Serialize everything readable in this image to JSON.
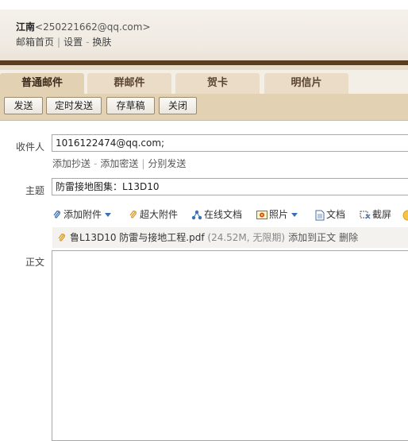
{
  "header": {
    "user_name": "江南",
    "user_email": "<250221662@qq.com>",
    "links": [
      "邮箱首页",
      "设置",
      "换肤"
    ]
  },
  "tabs": [
    {
      "label": "普通邮件",
      "active": true
    },
    {
      "label": "群邮件",
      "active": false
    },
    {
      "label": "贺卡",
      "active": false
    },
    {
      "label": "明信片",
      "active": false
    }
  ],
  "toolbar": {
    "send_label": "发送",
    "scheduled_label": "定时发送",
    "draft_label": "存草稿",
    "close_label": "关闭"
  },
  "compose": {
    "to_label": "收件人",
    "to_value": "1016122474@qq.com;",
    "cc_link": "添加抄送",
    "bcc_link": "添加密送",
    "separate_link": "分别发送",
    "subject_label": "主题",
    "subject_value": "防雷接地图集：L13D10",
    "body_label": "正文",
    "attach": {
      "add_attachment": "添加附件",
      "large_attachment": "超大附件",
      "online_doc": "在线文档",
      "photo": "照片",
      "document": "文档",
      "screenshot": "截屏"
    },
    "file": {
      "name": "鲁L13D10 防雷与接地工程.pdf",
      "meta": "(24.52M, 无限期)",
      "add_to_body": "添加到正文",
      "delete": "删除"
    }
  },
  "colors": {
    "wood_dark": "#5a3c1e",
    "tab_bg": "#eadcc6",
    "toolbar_bg": "#e3d1b4",
    "link_blue": "#3a6fb5"
  }
}
